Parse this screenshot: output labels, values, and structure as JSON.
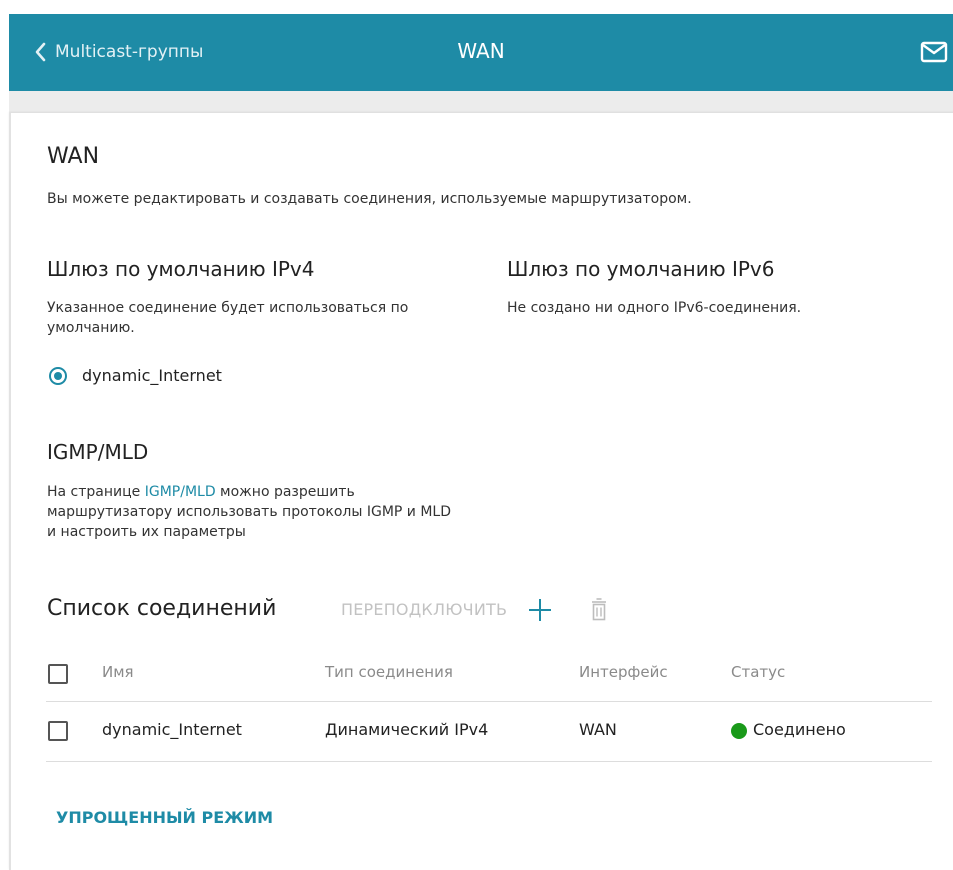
{
  "header": {
    "back_label": "Multicast-группы",
    "title": "WAN"
  },
  "page": {
    "heading": "WAN",
    "description": "Вы можете редактировать и создавать соединения, используемые маршрутизатором."
  },
  "ipv4": {
    "heading": "Шлюз по умолчанию IPv4",
    "description": "Указанное соединение будет использоваться по умолчанию.",
    "selected_connection": "dynamic_Internet"
  },
  "ipv6": {
    "heading": "Шлюз по умолчанию IPv6",
    "description": "Не создано ни одного IPv6-соединения."
  },
  "igmp": {
    "heading": "IGMP/MLD",
    "text_before": "На странице ",
    "link": "IGMP/MLD",
    "text_after": " можно разрешить маршрутизатору использовать протоколы IGMP и MLD и настроить их параметры"
  },
  "connections": {
    "heading": "Список соединений",
    "reconnect_label": "ПЕРЕПОДКЛЮЧИТЬ",
    "columns": [
      "Имя",
      "Тип соединения",
      "Интерфейс",
      "Статус"
    ],
    "rows": [
      {
        "name": "dynamic_Internet",
        "type": "Динамический IPv4",
        "interface": "WAN",
        "status": "Соединено",
        "status_color": "#1a9a1a"
      }
    ]
  },
  "footer": {
    "simple_mode_label": "УПРОЩЕННЫЙ РЕЖИМ"
  },
  "colors": {
    "accent": "#1e8ba6",
    "status_connected": "#1a9a1a"
  },
  "icons": {
    "back": "chevron-left-icon",
    "mail": "mail-icon",
    "add": "plus-icon",
    "delete": "trash-icon"
  }
}
